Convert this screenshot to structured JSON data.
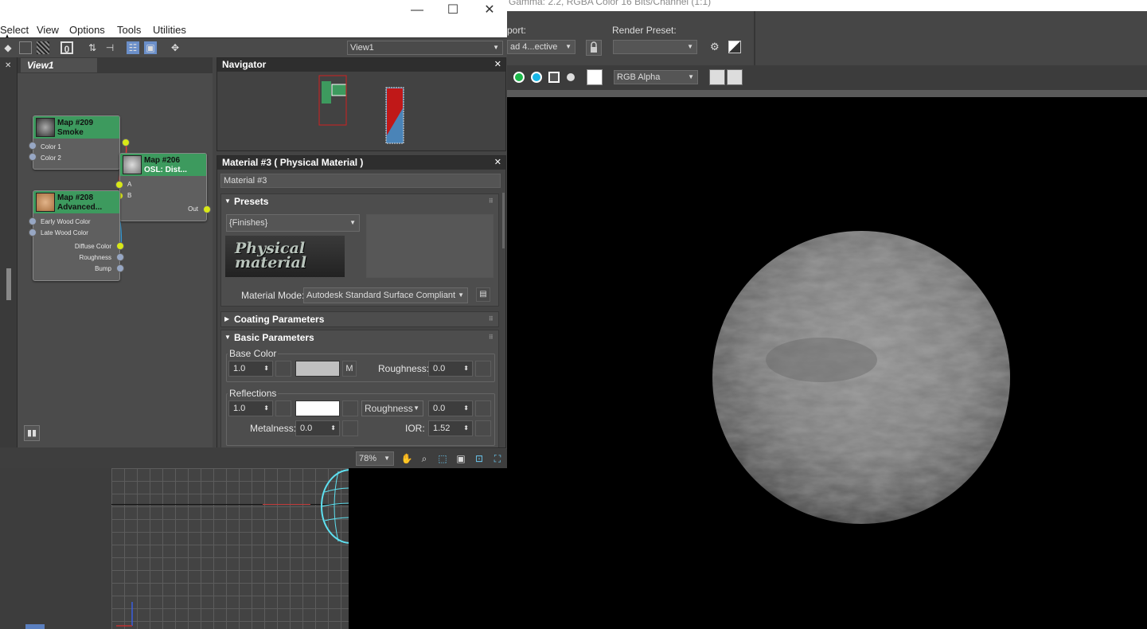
{
  "render_window": {
    "title": "Gamma: 2.2, RGBA Color 16 Bits/Channel (1:1)",
    "viewport_label": "port:",
    "viewport_value": "ad 4...ective",
    "render_preset_label": "Render Preset:",
    "render_preset_value": "",
    "channel_value": "RGB Alpha"
  },
  "slate": {
    "menu": [
      "Select",
      "View",
      "Options",
      "Tools",
      "Utilities"
    ],
    "view_dropdown": "View1",
    "tab": "View1",
    "zoom": "78%",
    "nodes": {
      "n209": {
        "line1": "Map #209",
        "line2": "Smoke",
        "slots": [
          "Color 1",
          "Color 2"
        ]
      },
      "n206": {
        "line1": "Map #206",
        "line2": "OSL: Dist...",
        "slots": [
          "A",
          "B"
        ],
        "out": "Out"
      },
      "n208": {
        "line1": "Map #208",
        "line2": "Advanced...",
        "slots": [
          "Early Wood Color",
          "Late Wood Color"
        ],
        "outs": [
          "Diffuse Color",
          "Roughness",
          "Bump"
        ]
      }
    }
  },
  "navigator": {
    "title": "Navigator"
  },
  "material": {
    "title": "Material #3  ( Physical Material )",
    "name": "Material #3",
    "presets_label": "Presets",
    "presets_value": "{Finishes}",
    "logo_text": "Physical material",
    "mode_label": "Material Mode:",
    "mode_value": "Autodesk Standard Surface Compliant",
    "coating_label": "Coating Parameters",
    "basic_label": "Basic Parameters",
    "base_color_label": "Base Color",
    "base_weight": "1.0",
    "m_label": "M",
    "base_roughness_label": "Roughness:",
    "base_roughness": "0.0",
    "reflections_label": "Reflections",
    "refl_weight": "1.0",
    "refl_mode": "Roughness",
    "refl_roughness": "0.0",
    "metalness_label": "Metalness:",
    "metalness": "0.0",
    "ior_label": "IOR:",
    "ior": "1.52"
  },
  "colors": {
    "node_header": "#3d9a5e",
    "socket_active": "#d8e817",
    "base_swatch": "#c0c0c0",
    "refl_swatch": "#ffffff"
  }
}
